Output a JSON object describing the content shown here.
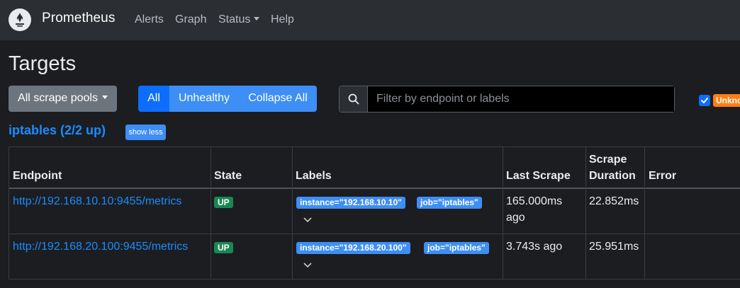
{
  "navbar": {
    "brand": "Prometheus",
    "links": [
      "Alerts",
      "Graph",
      "Status",
      "Help"
    ]
  },
  "page": {
    "title": "Targets",
    "pools_button": "All scrape pools",
    "filter_buttons": [
      "All",
      "Unhealthy",
      "Collapse All"
    ],
    "search_placeholder": "Filter by endpoint or labels",
    "unknown_badge": "Unknown"
  },
  "pool": {
    "title": "iptables (2/2 up)",
    "toggle_label": "show less"
  },
  "table": {
    "headers": {
      "endpoint": "Endpoint",
      "state": "State",
      "labels": "Labels",
      "last_scrape": "Last Scrape",
      "scrape_duration": "Scrape Duration",
      "error": "Error"
    },
    "rows": [
      {
        "endpoint": "http://192.168.10.10:9455/metrics",
        "state": "UP",
        "labels": [
          "instance=\"192.168.10.10\"",
          "job=\"iptables\""
        ],
        "last_scrape": "165.000ms ago",
        "scrape_duration": "22.852ms",
        "error": ""
      },
      {
        "endpoint": "http://192.168.20.100:9455/metrics",
        "state": "UP",
        "labels": [
          "instance=\"192.168.20.100\"",
          "job=\"iptables\""
        ],
        "last_scrape": "3.743s ago",
        "scrape_duration": "25.951ms",
        "error": ""
      }
    ]
  },
  "colors": {
    "primary": "#0d6efd",
    "link": "#1a8cff",
    "success": "#198754",
    "warning": "#fd7e14"
  },
  "icons": {
    "logo": "prometheus-flame-icon",
    "search": "search-icon",
    "checkbox": "checkmark-icon",
    "expand": "chevron-down-icon"
  }
}
